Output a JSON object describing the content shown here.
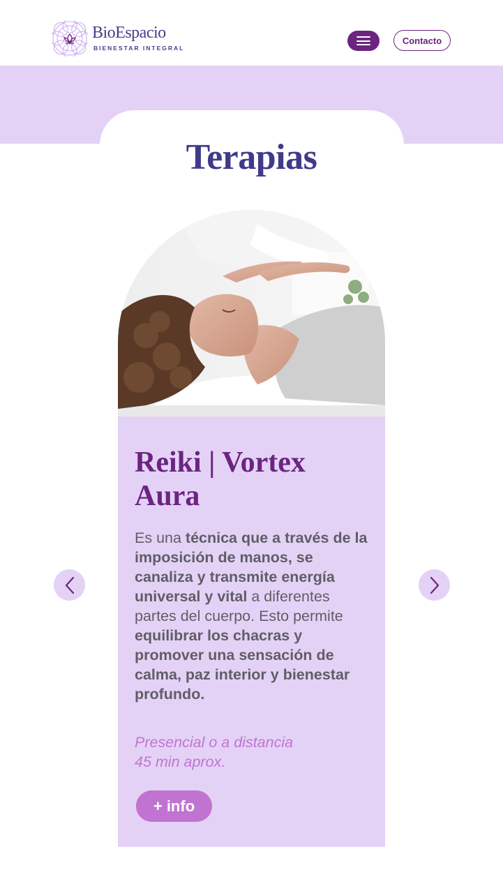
{
  "header": {
    "logo_name": "BioEspacio",
    "logo_tagline": "BIENESTAR INTEGRAL",
    "menu_icon": "hamburger-menu-icon",
    "contact_label": "Contacto"
  },
  "section": {
    "title": "Terapias"
  },
  "card": {
    "image_alt": "woman-receiving-reiki-photo",
    "title": "Reiki | Vortex Aura",
    "desc_part1": "Es una ",
    "desc_bold1": "técnica que a través de la imposición de manos, se canaliza y transmite energía universal y vital",
    "desc_part2": " a diferentes partes del cuerpo. Esto permite ",
    "desc_bold2": "equilibrar los chacras y promover una sensación de calma, paz interior y bienestar profundo.",
    "meta_line1": "Presencial o a distancia",
    "meta_line2": "45 min aprox.",
    "info_label": "+ info"
  },
  "carousel": {
    "prev_icon": "chevron-left-icon",
    "next_icon": "chevron-right-icon"
  },
  "colors": {
    "brand_purple": "#6b2480",
    "title_indigo": "#3f3a8a",
    "lavender": "#e4d2f6",
    "accent_pink": "#c173d1",
    "text_gray": "#605d66"
  }
}
